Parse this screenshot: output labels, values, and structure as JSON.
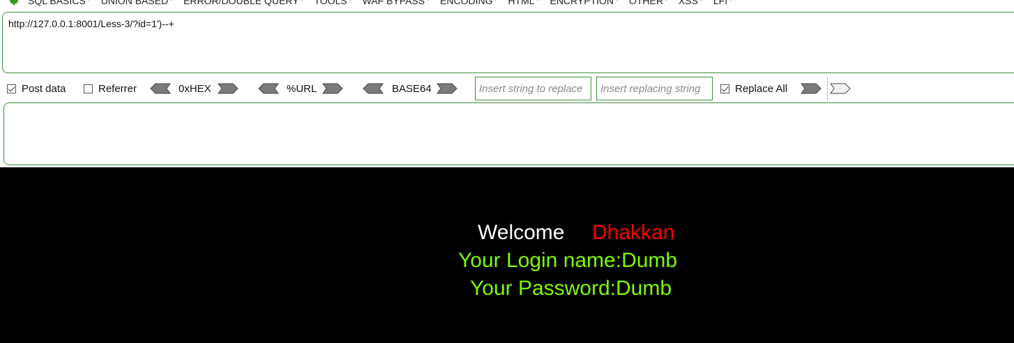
{
  "menu": {
    "items": [
      "SQL BASICS",
      "UNION BASED",
      "ERROR/DOUBLE QUERY",
      "TOOLS",
      "WAF BYPASS",
      "ENCODING",
      "HTML",
      "ENCRYPTION",
      "OTHER",
      "XSS",
      "LFI"
    ]
  },
  "url_bar": {
    "value": "http://127.0.0.1:8001/Less-3/?id=1')--+"
  },
  "controls": {
    "post_data_label": "Post data",
    "referrer_label": "Referrer",
    "hex_label": "0xHEX",
    "url_label": "%URL",
    "base64_label": "BASE64",
    "insert_string_placeholder": "Insert string to replace",
    "insert_replacing_placeholder": "Insert replacing string",
    "replace_all_label": "Replace All"
  },
  "page": {
    "welcome": "Welcome",
    "name": "Dhakkan",
    "login_line": "Your Login name:Dumb",
    "password_line": "Your Password:Dumb"
  },
  "colors": {
    "border_green": "#3c8f3c",
    "welcome_white": "#ffffff",
    "name_red": "#ff0000",
    "info_green": "#7cfc00"
  }
}
